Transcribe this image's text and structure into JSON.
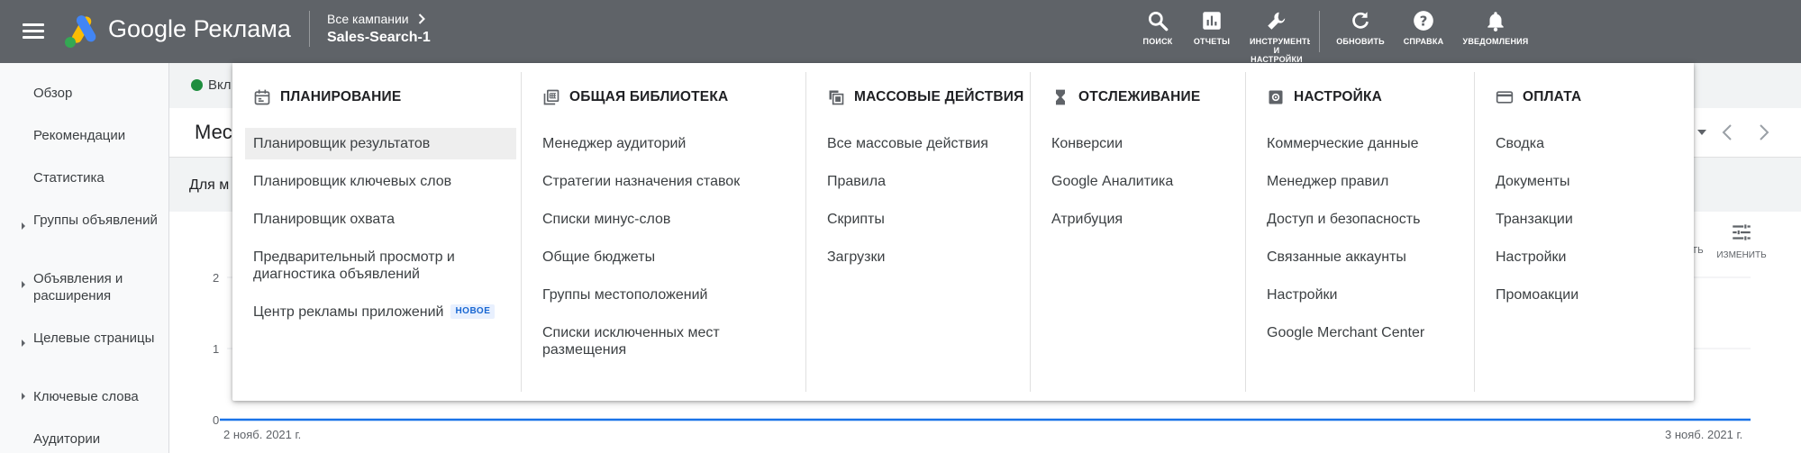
{
  "header": {
    "brand": "Google Реклама",
    "breadcrumb_parent": "Все кампании",
    "campaign": "Sales-Search-1",
    "tools": [
      {
        "label": "ПОИСК",
        "icon": "search-icon"
      },
      {
        "label": "ОТЧЕТЫ",
        "icon": "reports-icon"
      },
      {
        "label": "ИНСТРУМЕНТЫ И НАСТРОЙКИ",
        "icon": "wrench-icon"
      },
      {
        "label": "ОБНОВИТЬ",
        "icon": "refresh-icon"
      },
      {
        "label": "СПРАВКА",
        "icon": "help-icon"
      },
      {
        "label": "УВЕДОМЛЕНИЯ",
        "icon": "bell-icon"
      }
    ]
  },
  "sidebar": {
    "items": [
      {
        "label": "Обзор",
        "expandable": false
      },
      {
        "label": "Рекомендации",
        "expandable": false
      },
      {
        "label": "Статистика",
        "expandable": false
      },
      {
        "label": "Группы объявлений",
        "expandable": true
      },
      {
        "label": "Объявления и расширения",
        "expandable": true
      },
      {
        "label": "Целевые страницы",
        "expandable": true
      },
      {
        "label": "Ключевые слова",
        "expandable": true
      },
      {
        "label": "Аудитории",
        "expandable": false
      }
    ]
  },
  "background": {
    "status_text": "Вкл",
    "card_title_partial": "Мес",
    "subbar_partial": "Для м",
    "edit_label": "ИЗМЕНИТЬ",
    "partial_tool_label": "ТЬ",
    "chart": {
      "y_ticks": [
        "2",
        "1",
        "0"
      ],
      "x_labels": [
        "2 нояб. 2021 г.",
        "3 нояб. 2021 г."
      ]
    }
  },
  "menu": {
    "columns": [
      {
        "title": "ПЛАНИРОВАНИЕ",
        "icon": "calendar-icon",
        "items": [
          {
            "label": "Планировщик результатов",
            "active": true
          },
          {
            "label": "Планировщик ключевых слов"
          },
          {
            "label": "Планировщик охвата"
          },
          {
            "label": "Предварительный просмотр и диагностика объявлений"
          },
          {
            "label": "Центр рекламы приложений",
            "badge": "НОВОЕ"
          }
        ]
      },
      {
        "title": "ОБЩАЯ БИБЛИОТЕКА",
        "icon": "library-icon",
        "items": [
          {
            "label": "Менеджер аудиторий"
          },
          {
            "label": "Стратегии назначения ставок"
          },
          {
            "label": "Списки минус-слов"
          },
          {
            "label": "Общие бюджеты"
          },
          {
            "label": "Группы местоположений"
          },
          {
            "label": "Списки исключенных мест размещения"
          }
        ]
      },
      {
        "title": "МАССОВЫЕ ДЕЙСТВИЯ",
        "icon": "copy-icon",
        "items": [
          {
            "label": "Все массовые действия"
          },
          {
            "label": "Правила"
          },
          {
            "label": "Скрипты"
          },
          {
            "label": "Загрузки"
          }
        ]
      },
      {
        "title": "ОТСЛЕЖИВАНИЕ",
        "icon": "hourglass-icon",
        "items": [
          {
            "label": "Конверсии"
          },
          {
            "label": "Google Аналитика"
          },
          {
            "label": "Атрибуция"
          }
        ]
      },
      {
        "title": "НАСТРОЙКА",
        "icon": "settings-icon",
        "items": [
          {
            "label": "Коммерческие данные"
          },
          {
            "label": "Менеджер правил"
          },
          {
            "label": "Доступ и безопасность"
          },
          {
            "label": "Связанные аккаунты"
          },
          {
            "label": "Настройки"
          },
          {
            "label": "Google Merchant Center"
          }
        ]
      },
      {
        "title": "ОПЛАТА",
        "icon": "credit-card-icon",
        "items": [
          {
            "label": "Сводка"
          },
          {
            "label": "Документы"
          },
          {
            "label": "Транзакции"
          },
          {
            "label": "Настройки"
          },
          {
            "label": "Промоакции"
          }
        ]
      }
    ]
  },
  "colors": {
    "header_bg": "#5f6368",
    "accent_blue": "#1a73e8",
    "status_green": "#1e8e3e",
    "logo_yellow": "#fbbc04",
    "logo_green": "#34a853",
    "logo_blue": "#4285f4"
  }
}
